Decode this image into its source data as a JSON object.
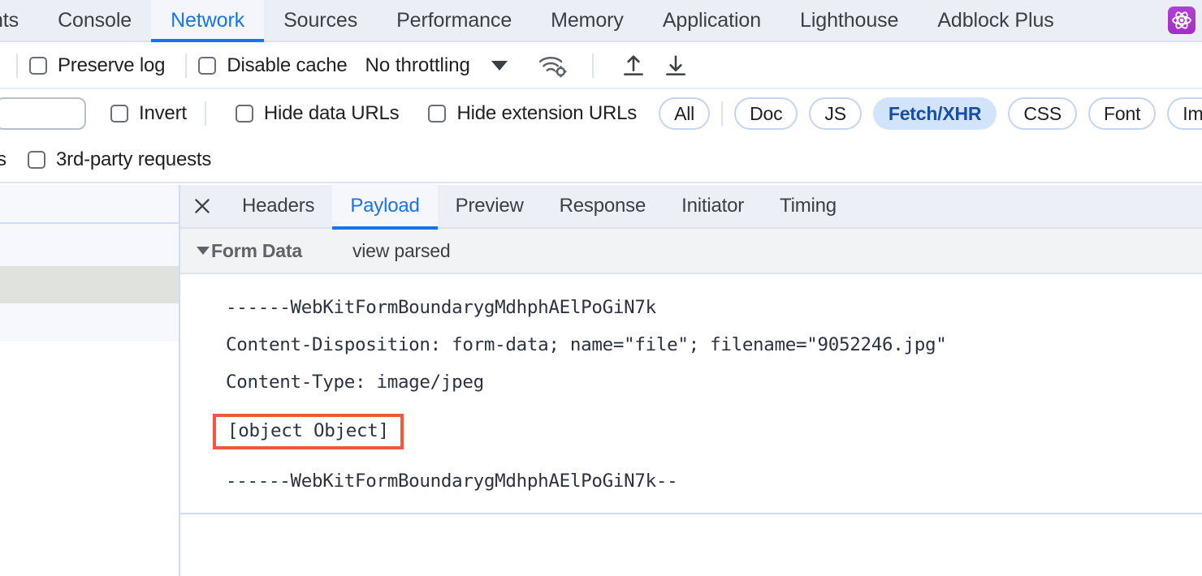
{
  "devtools": {
    "tabs": [
      {
        "label": "nts",
        "active": false,
        "clipped": true
      },
      {
        "label": "Console",
        "active": false
      },
      {
        "label": "Network",
        "active": true
      },
      {
        "label": "Sources",
        "active": false
      },
      {
        "label": "Performance",
        "active": false
      },
      {
        "label": "Memory",
        "active": false
      },
      {
        "label": "Application",
        "active": false
      },
      {
        "label": "Lighthouse",
        "active": false
      },
      {
        "label": "Adblock Plus",
        "active": false
      }
    ],
    "extension_icon": "atom-icon",
    "extension_icon_color": "#a32ec4"
  },
  "toolbar": {
    "preserve_log_label": "Preserve log",
    "disable_cache_label": "Disable cache",
    "throttling_value": "No throttling",
    "throttling_caret": "chevron-down-icon",
    "wifi_settings_icon": "wifi-gear-icon",
    "import_har_icon": "upload-arrow-icon",
    "export_har_icon": "download-arrow-icon"
  },
  "filterbar": {
    "filter_value": "",
    "filter_placeholder": "",
    "invert_label": "Invert",
    "hide_data_urls_label": "Hide data URLs",
    "hide_extension_urls_label": "Hide extension URLs",
    "types": [
      {
        "label": "All",
        "selected": false,
        "clipped": true
      },
      {
        "label": "Doc",
        "selected": false
      },
      {
        "label": "JS",
        "selected": false
      },
      {
        "label": "Fetch/XHR",
        "selected": true
      },
      {
        "label": "CSS",
        "selected": false
      },
      {
        "label": "Font",
        "selected": false
      },
      {
        "label": "Img",
        "selected": false
      }
    ],
    "selected_type_bg": "#d2e3fc",
    "selected_type_fg": "#174ea6"
  },
  "thirdparty": {
    "clipped_prefix": "s",
    "label": "3rd-party requests"
  },
  "detail": {
    "close_icon": "close-icon",
    "tabs": [
      {
        "label": "Headers",
        "active": false
      },
      {
        "label": "Payload",
        "active": true
      },
      {
        "label": "Preview",
        "active": false
      },
      {
        "label": "Response",
        "active": false
      },
      {
        "label": "Initiator",
        "active": false
      },
      {
        "label": "Timing",
        "active": false
      }
    ],
    "active_tab_color": "#1a73e8"
  },
  "form_data": {
    "caret_icon": "triangle-down-icon",
    "title": "Form Data",
    "view_parsed_label": "view parsed",
    "lines": [
      "------WebKitFormBoundarygMdhphAElPoGiN7k",
      "Content-Disposition: form-data; name=\"file\"; filename=\"9052246.jpg\"",
      "Content-Type: image/jpeg",
      ""
    ],
    "highlighted_line": "[object Object]",
    "highlight_border_color": "#f4573f",
    "closing_boundary": "------WebKitFormBoundarygMdhphAElPoGiN7k--"
  },
  "request_list": {
    "rows": [
      {
        "kind": "hdr"
      },
      {
        "kind": "normal"
      },
      {
        "kind": "sel"
      },
      {
        "kind": "tail"
      }
    ],
    "selected_row_color": "#e0e2dd"
  }
}
